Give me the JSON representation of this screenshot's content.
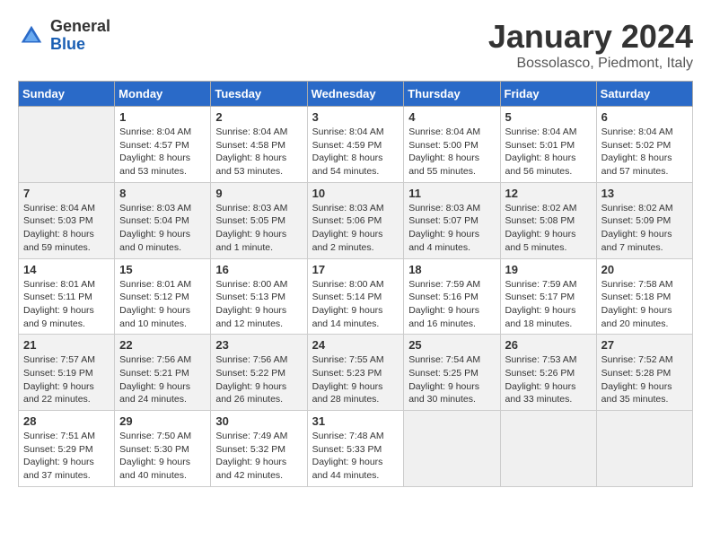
{
  "header": {
    "logo_general": "General",
    "logo_blue": "Blue",
    "title": "January 2024",
    "subtitle": "Bossolasco, Piedmont, Italy"
  },
  "weekdays": [
    "Sunday",
    "Monday",
    "Tuesday",
    "Wednesday",
    "Thursday",
    "Friday",
    "Saturday"
  ],
  "weeks": [
    [
      {
        "day": "",
        "sunrise": "",
        "sunset": "",
        "daylight": ""
      },
      {
        "day": "1",
        "sunrise": "Sunrise: 8:04 AM",
        "sunset": "Sunset: 4:57 PM",
        "daylight": "Daylight: 8 hours and 53 minutes."
      },
      {
        "day": "2",
        "sunrise": "Sunrise: 8:04 AM",
        "sunset": "Sunset: 4:58 PM",
        "daylight": "Daylight: 8 hours and 53 minutes."
      },
      {
        "day": "3",
        "sunrise": "Sunrise: 8:04 AM",
        "sunset": "Sunset: 4:59 PM",
        "daylight": "Daylight: 8 hours and 54 minutes."
      },
      {
        "day": "4",
        "sunrise": "Sunrise: 8:04 AM",
        "sunset": "Sunset: 5:00 PM",
        "daylight": "Daylight: 8 hours and 55 minutes."
      },
      {
        "day": "5",
        "sunrise": "Sunrise: 8:04 AM",
        "sunset": "Sunset: 5:01 PM",
        "daylight": "Daylight: 8 hours and 56 minutes."
      },
      {
        "day": "6",
        "sunrise": "Sunrise: 8:04 AM",
        "sunset": "Sunset: 5:02 PM",
        "daylight": "Daylight: 8 hours and 57 minutes."
      }
    ],
    [
      {
        "day": "7",
        "sunrise": "Sunrise: 8:04 AM",
        "sunset": "Sunset: 5:03 PM",
        "daylight": "Daylight: 8 hours and 59 minutes."
      },
      {
        "day": "8",
        "sunrise": "Sunrise: 8:03 AM",
        "sunset": "Sunset: 5:04 PM",
        "daylight": "Daylight: 9 hours and 0 minutes."
      },
      {
        "day": "9",
        "sunrise": "Sunrise: 8:03 AM",
        "sunset": "Sunset: 5:05 PM",
        "daylight": "Daylight: 9 hours and 1 minute."
      },
      {
        "day": "10",
        "sunrise": "Sunrise: 8:03 AM",
        "sunset": "Sunset: 5:06 PM",
        "daylight": "Daylight: 9 hours and 2 minutes."
      },
      {
        "day": "11",
        "sunrise": "Sunrise: 8:03 AM",
        "sunset": "Sunset: 5:07 PM",
        "daylight": "Daylight: 9 hours and 4 minutes."
      },
      {
        "day": "12",
        "sunrise": "Sunrise: 8:02 AM",
        "sunset": "Sunset: 5:08 PM",
        "daylight": "Daylight: 9 hours and 5 minutes."
      },
      {
        "day": "13",
        "sunrise": "Sunrise: 8:02 AM",
        "sunset": "Sunset: 5:09 PM",
        "daylight": "Daylight: 9 hours and 7 minutes."
      }
    ],
    [
      {
        "day": "14",
        "sunrise": "Sunrise: 8:01 AM",
        "sunset": "Sunset: 5:11 PM",
        "daylight": "Daylight: 9 hours and 9 minutes."
      },
      {
        "day": "15",
        "sunrise": "Sunrise: 8:01 AM",
        "sunset": "Sunset: 5:12 PM",
        "daylight": "Daylight: 9 hours and 10 minutes."
      },
      {
        "day": "16",
        "sunrise": "Sunrise: 8:00 AM",
        "sunset": "Sunset: 5:13 PM",
        "daylight": "Daylight: 9 hours and 12 minutes."
      },
      {
        "day": "17",
        "sunrise": "Sunrise: 8:00 AM",
        "sunset": "Sunset: 5:14 PM",
        "daylight": "Daylight: 9 hours and 14 minutes."
      },
      {
        "day": "18",
        "sunrise": "Sunrise: 7:59 AM",
        "sunset": "Sunset: 5:16 PM",
        "daylight": "Daylight: 9 hours and 16 minutes."
      },
      {
        "day": "19",
        "sunrise": "Sunrise: 7:59 AM",
        "sunset": "Sunset: 5:17 PM",
        "daylight": "Daylight: 9 hours and 18 minutes."
      },
      {
        "day": "20",
        "sunrise": "Sunrise: 7:58 AM",
        "sunset": "Sunset: 5:18 PM",
        "daylight": "Daylight: 9 hours and 20 minutes."
      }
    ],
    [
      {
        "day": "21",
        "sunrise": "Sunrise: 7:57 AM",
        "sunset": "Sunset: 5:19 PM",
        "daylight": "Daylight: 9 hours and 22 minutes."
      },
      {
        "day": "22",
        "sunrise": "Sunrise: 7:56 AM",
        "sunset": "Sunset: 5:21 PM",
        "daylight": "Daylight: 9 hours and 24 minutes."
      },
      {
        "day": "23",
        "sunrise": "Sunrise: 7:56 AM",
        "sunset": "Sunset: 5:22 PM",
        "daylight": "Daylight: 9 hours and 26 minutes."
      },
      {
        "day": "24",
        "sunrise": "Sunrise: 7:55 AM",
        "sunset": "Sunset: 5:23 PM",
        "daylight": "Daylight: 9 hours and 28 minutes."
      },
      {
        "day": "25",
        "sunrise": "Sunrise: 7:54 AM",
        "sunset": "Sunset: 5:25 PM",
        "daylight": "Daylight: 9 hours and 30 minutes."
      },
      {
        "day": "26",
        "sunrise": "Sunrise: 7:53 AM",
        "sunset": "Sunset: 5:26 PM",
        "daylight": "Daylight: 9 hours and 33 minutes."
      },
      {
        "day": "27",
        "sunrise": "Sunrise: 7:52 AM",
        "sunset": "Sunset: 5:28 PM",
        "daylight": "Daylight: 9 hours and 35 minutes."
      }
    ],
    [
      {
        "day": "28",
        "sunrise": "Sunrise: 7:51 AM",
        "sunset": "Sunset: 5:29 PM",
        "daylight": "Daylight: 9 hours and 37 minutes."
      },
      {
        "day": "29",
        "sunrise": "Sunrise: 7:50 AM",
        "sunset": "Sunset: 5:30 PM",
        "daylight": "Daylight: 9 hours and 40 minutes."
      },
      {
        "day": "30",
        "sunrise": "Sunrise: 7:49 AM",
        "sunset": "Sunset: 5:32 PM",
        "daylight": "Daylight: 9 hours and 42 minutes."
      },
      {
        "day": "31",
        "sunrise": "Sunrise: 7:48 AM",
        "sunset": "Sunset: 5:33 PM",
        "daylight": "Daylight: 9 hours and 44 minutes."
      },
      {
        "day": "",
        "sunrise": "",
        "sunset": "",
        "daylight": ""
      },
      {
        "day": "",
        "sunrise": "",
        "sunset": "",
        "daylight": ""
      },
      {
        "day": "",
        "sunrise": "",
        "sunset": "",
        "daylight": ""
      }
    ]
  ]
}
